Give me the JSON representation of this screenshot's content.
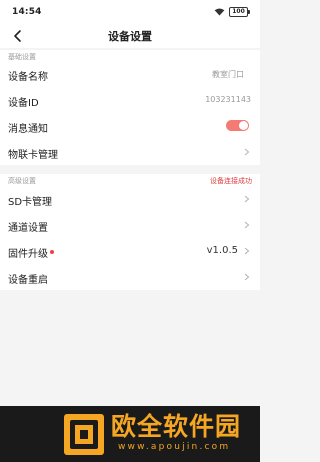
{
  "status_bar": {
    "time": "14:54",
    "battery": "100"
  },
  "header": {
    "title": "设备设置"
  },
  "basic_section": {
    "title": "基础设置",
    "device_name_label": "设备名称",
    "device_name_value": "教室门口",
    "device_id_label": "设备ID",
    "device_id_value": "103231143",
    "notification_label": "消息通知",
    "notification_on": true,
    "iot_card_label": "物联卡管理"
  },
  "advanced_section": {
    "title": "高级设置",
    "connection_status": "设备连接成功",
    "sd_card_label": "SD卡管理",
    "channel_label": "通道设置",
    "firmware_label": "固件升级",
    "firmware_version": "v1.0.5",
    "restart_label": "设备重启"
  },
  "watermark": {
    "brand": "欧全软件园",
    "url": "www.apoujin.com"
  },
  "colors": {
    "accent": "#f47a74",
    "status_red": "#e03e3e",
    "watermark_orange": "#f5a623"
  }
}
